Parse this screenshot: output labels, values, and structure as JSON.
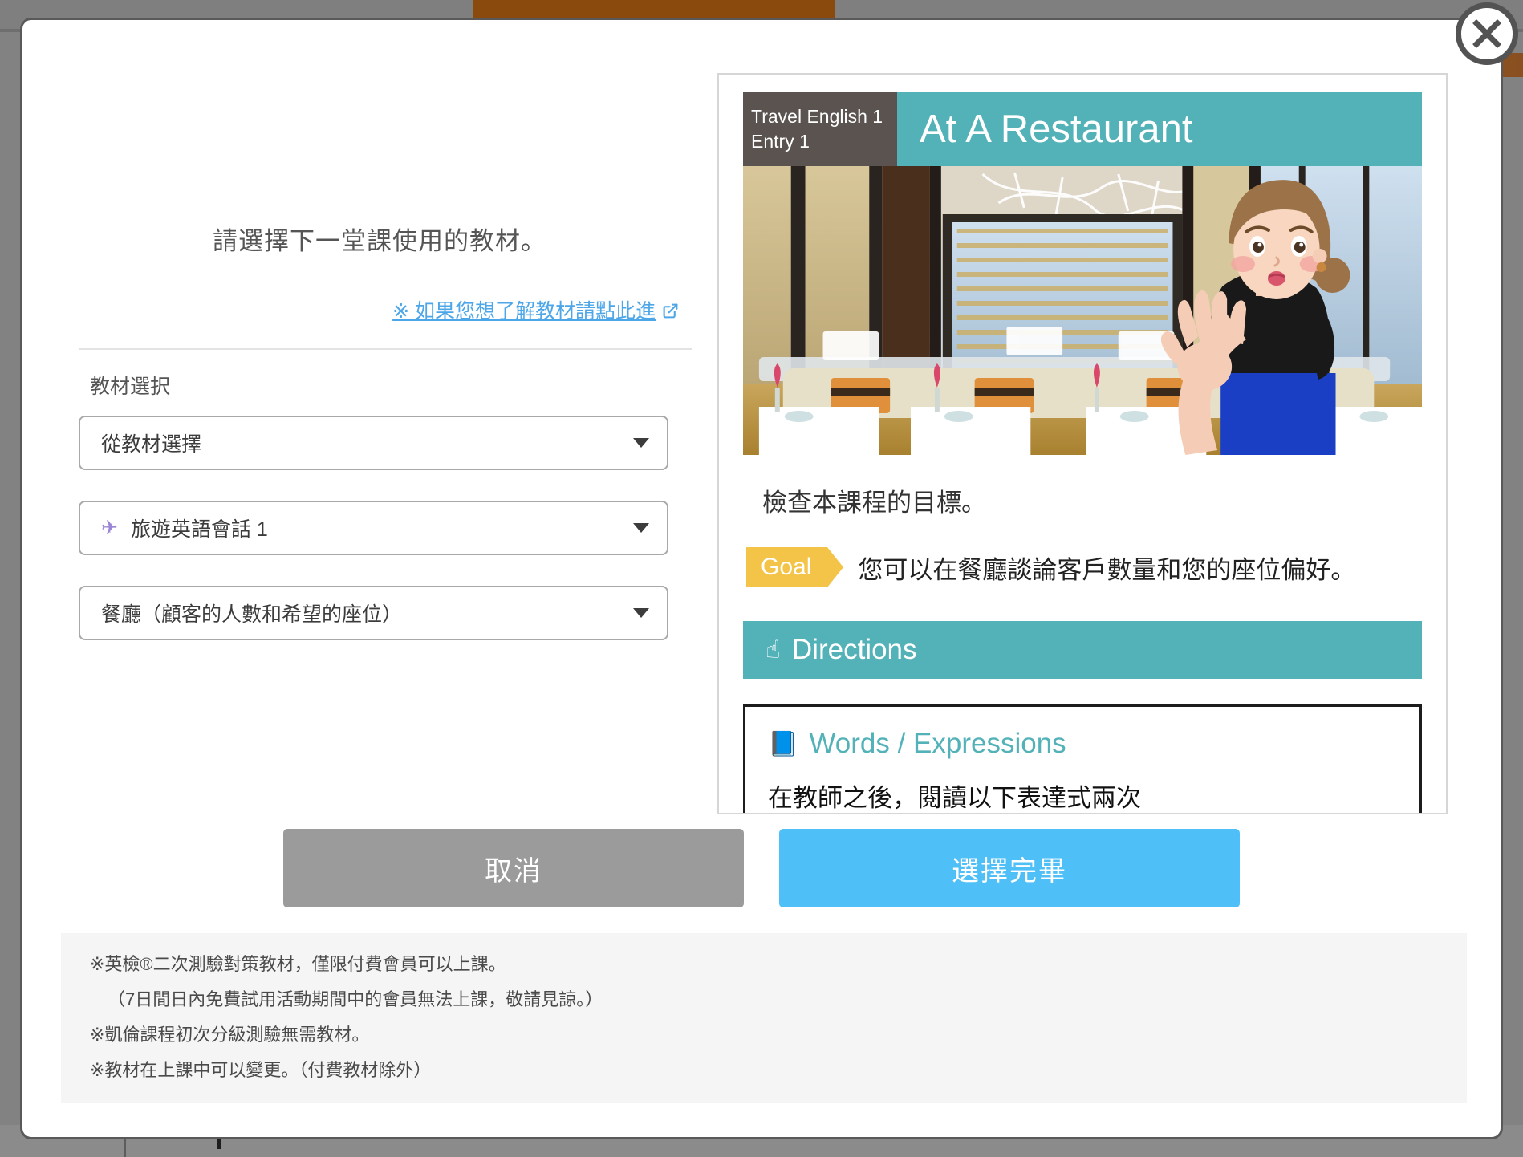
{
  "modal": {
    "close_label": "×",
    "prompt": "請選擇下一堂課使用的教材。",
    "material_link": "※ 如果您想了解教材請點此進",
    "field_label": "教材選択"
  },
  "selects": [
    {
      "name": "source",
      "value": "從教材選擇",
      "icon": ""
    },
    {
      "name": "course",
      "value": "旅遊英語會話 1",
      "icon": "✈"
    },
    {
      "name": "lesson",
      "value": "餐廳（顧客的人數和希望的座位）",
      "icon": ""
    }
  ],
  "preview": {
    "tag_line1": "Travel English 1",
    "tag_line2": "Entry 1",
    "title": "At A Restaurant",
    "check_goal": "檢查本課程的目標。",
    "goal_badge": "Goal",
    "goal_text": "您可以在餐廳談論客戶數量和您的座位偏好。",
    "directions": "Directions",
    "directions_icon": "☝",
    "words_title": "Words / Expressions",
    "words_icon": "📘",
    "words_sub": "在教師之後，閱讀以下表達式兩次"
  },
  "actions": {
    "cancel": "取消",
    "confirm": "選擇完畢"
  },
  "notes": [
    "※英檢®二次測驗對策教材，僅限付費會員可以上課。",
    "（7日間日內免費試用活動期間中的會員無法上課，敬請見諒。）",
    "※凱倫課程初次分級測驗無需教材。",
    "※教材在上課中可以變更。（付費教材除外）"
  ],
  "colors": {
    "teal": "#53b2b8",
    "accent_blue": "#4fc0f7",
    "goal_yellow": "#f3c447",
    "cancel_grey": "#9b9b9b",
    "link_blue": "#4da6e8"
  }
}
